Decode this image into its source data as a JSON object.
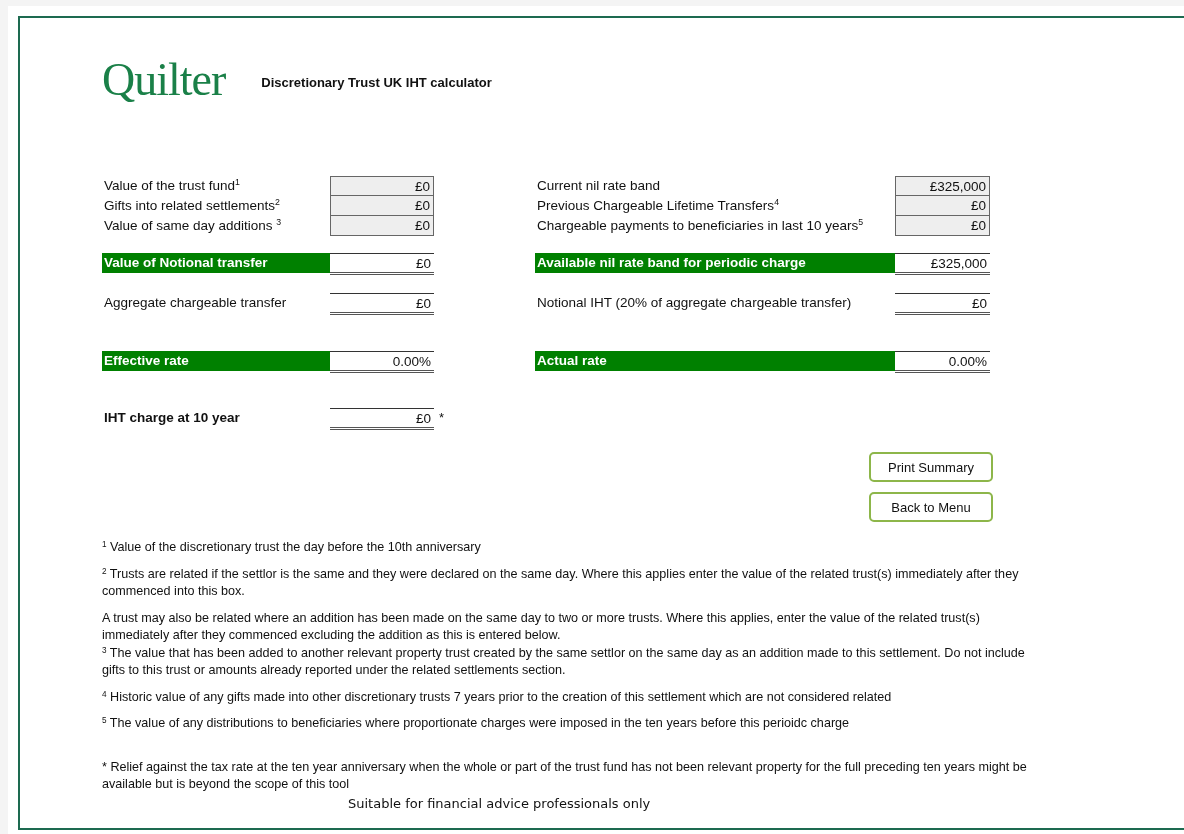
{
  "logo": "Quilter",
  "title": "Discretionary Trust UK IHT calculator",
  "inputs": {
    "left": [
      {
        "label": "Value of the trust fund$^{1}$",
        "value": "£0"
      },
      {
        "label": "Gifts into related settlements$^{2}$",
        "value": "£0"
      },
      {
        "label": "Value of same day additions $^{3}$",
        "value": "£0"
      }
    ],
    "right": [
      {
        "label": "Current nil rate band",
        "value": "£325,000"
      },
      {
        "label": "Previous Chargeable Lifetime Transfers$^{4}$",
        "value": "£0"
      },
      {
        "label": "Chargeable payments to beneficiaries in last 10 years$^{5}$",
        "value": "£0"
      }
    ]
  },
  "results": [
    {
      "left": {
        "kind": "highlight",
        "label": "Value of Notional transfer",
        "value": "£0"
      },
      "right": {
        "kind": "highlight",
        "label": "Available nil rate band for periodic charge",
        "value": "£325,000"
      }
    },
    {
      "left": {
        "kind": "plain",
        "label": "Aggregate chargeable transfer",
        "value": "£0"
      },
      "right": {
        "kind": "plain",
        "label": "Notional IHT (20% of aggregate chargeable transfer)",
        "value": "£0"
      }
    },
    {
      "left": {
        "kind": "highlight",
        "label": "Effective rate",
        "value": "0.00%"
      },
      "right": {
        "kind": "highlight",
        "label": "Actual rate",
        "value": "0.00%"
      }
    },
    {
      "left": {
        "kind": "bold",
        "label": "IHT charge at 10 year",
        "value": "£0",
        "note": "*"
      }
    }
  ],
  "buttons": [
    "Print Summary",
    "Back to Menu"
  ],
  "notes": [
    {
      "kind": "footnote",
      "text": "$^{1}$ Value of the discretionary trust the day before the 10th anniversary"
    },
    {
      "kind": "footnote",
      "text": "$^{2}$ Trusts are related if the settlor is the same and they were declared on the same day. Where this applies enter the value of the related trust(s) immediately after they commenced into this box."
    },
    {
      "kind": "footnote",
      "text": "A trust may also be related where an addition has been made on the same day to two or more trusts. Where this applies, enter the value of the related trust(s) immediately after they commenced excluding the addition as this is entered below."
    },
    {
      "kind": "continued",
      "text": "$^{3}$ The value that has been added to another relevant property trust created by the same settlor on the same day as an addition made to this settlement. Do not include gifts to this trust or amounts already reported under the related settlements section."
    },
    {
      "kind": "footnote",
      "text": "$^{4}$ Historic value of any gifts made into other discretionary trusts 7 years prior to the creation of this settlement which are not considered related"
    },
    {
      "kind": "footnote",
      "text": "$^{5}$ The value of any distributions to beneficiaries where proportionate charges were imposed in the ten years before this perioidc charge"
    },
    {
      "kind": "star",
      "text": "* Relief against the tax rate at the ten year anniversary when the whole or part of the trust fund has not been relevant property for the full preceding ten years might be available but is beyond the scope of this tool"
    }
  ],
  "footer": "Suitable for financial advice professionals only"
}
